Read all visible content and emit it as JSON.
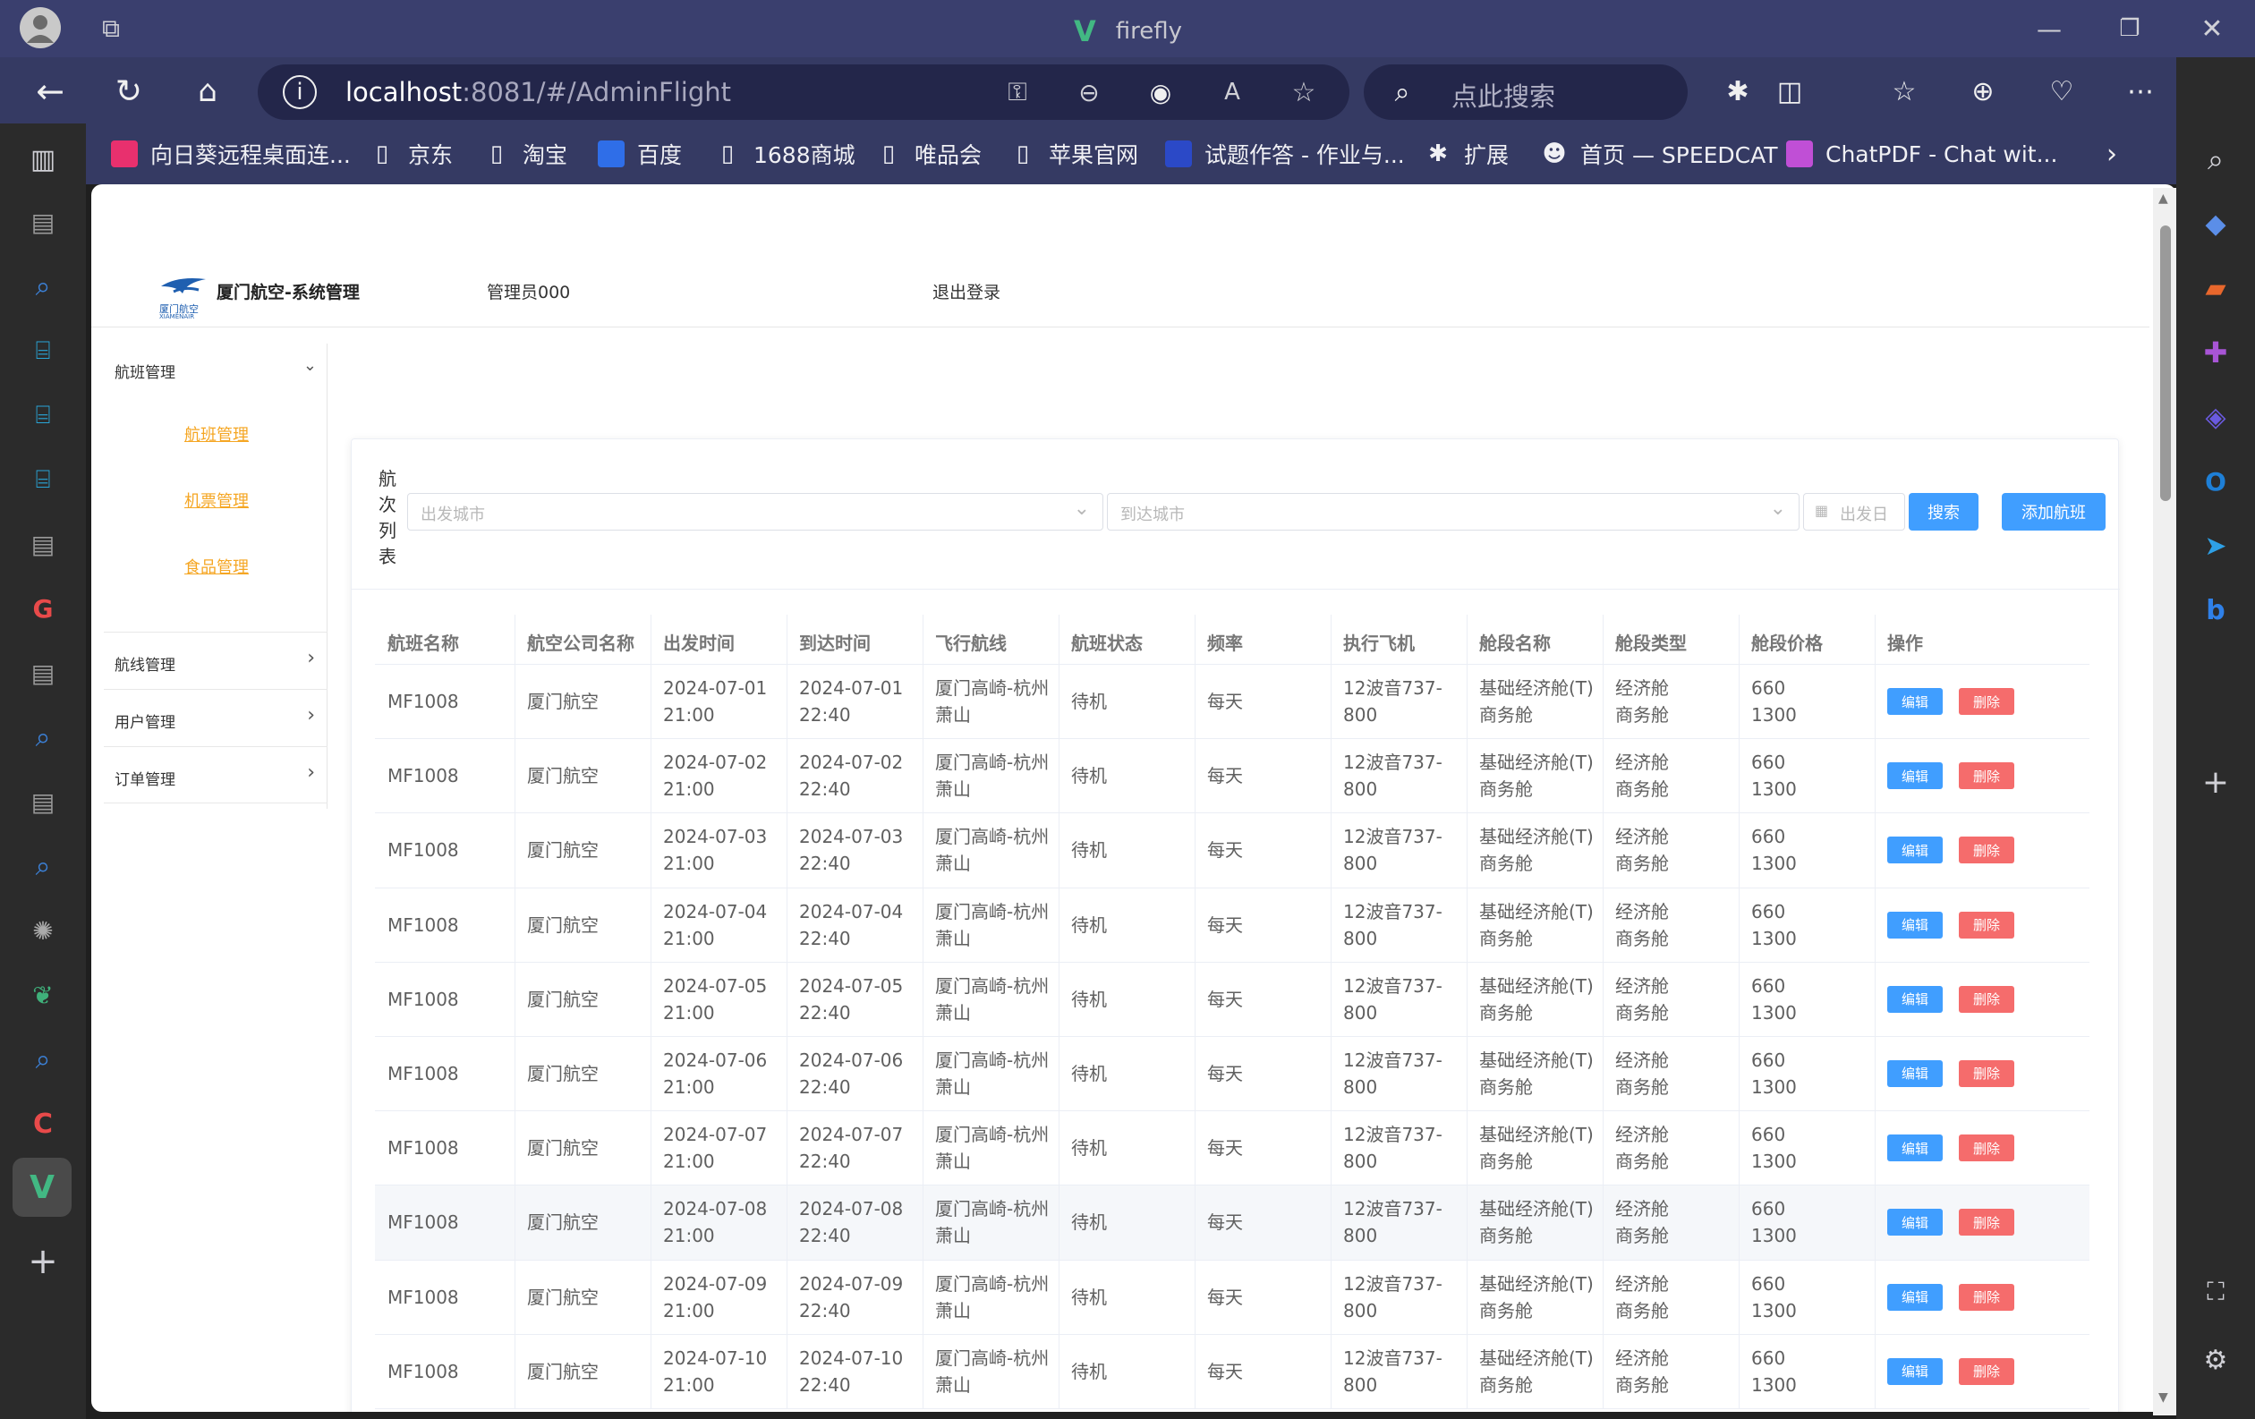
{
  "browser": {
    "window_title": "firefly",
    "url_host": "localhost",
    "url_rest": ":8081/#/AdminFlight",
    "search_placeholder": "点此搜索",
    "favorites": [
      {
        "label": "向日葵远程桌面连...",
        "icon": "sunflower-icon",
        "color": "#e8306e"
      },
      {
        "label": "京东",
        "icon": "page-icon",
        "color": "transparent"
      },
      {
        "label": "淘宝",
        "icon": "page-icon",
        "color": "transparent"
      },
      {
        "label": "百度",
        "icon": "baidu-icon",
        "color": "#2f6ee8"
      },
      {
        "label": "1688商城",
        "icon": "page-icon",
        "color": "transparent"
      },
      {
        "label": "唯品会",
        "icon": "page-icon",
        "color": "transparent"
      },
      {
        "label": "苹果官网",
        "icon": "page-icon",
        "color": "transparent"
      },
      {
        "label": "试题作答 - 作业与...",
        "icon": "u-icon",
        "color": "#2b49c7"
      },
      {
        "label": "扩展",
        "icon": "puzzle-icon",
        "color": "transparent"
      },
      {
        "label": "首页 — SPEEDCAT",
        "icon": "cat-icon",
        "color": "transparent"
      },
      {
        "label": "ChatPDF - Chat wit...",
        "icon": "chatpdf-icon",
        "color": "#c04fd6"
      }
    ]
  },
  "app": {
    "brand_title": "厦门航空-系统管理",
    "logo_text": "厦门航空",
    "logo_sub": "XIAMENAIR",
    "user": "管理员000",
    "logout": "退出登录"
  },
  "sidebar": {
    "groups": [
      {
        "label": "航班管理",
        "expanded": true,
        "children": [
          "航班管理",
          "机票管理",
          "食品管理"
        ]
      },
      {
        "label": "航线管理",
        "expanded": false
      },
      {
        "label": "用户管理",
        "expanded": false
      },
      {
        "label": "订单管理",
        "expanded": false
      }
    ]
  },
  "panel": {
    "title": "航次列表",
    "from_placeholder": "出发城市",
    "to_placeholder": "到达城市",
    "date_placeholder": "出发日",
    "search_btn": "搜索",
    "add_btn": "添加航班"
  },
  "table": {
    "columns": [
      "航班名称",
      "航空公司名称",
      "出发时间",
      "到达时间",
      "飞行航线",
      "航班状态",
      "频率",
      "执行飞机",
      "舱段名称",
      "舱段类型",
      "舱段价格",
      "操作"
    ],
    "edit_label": "编辑",
    "delete_label": "删除",
    "rows": [
      {
        "name": "MF1008",
        "company": "厦门航空",
        "dep_date": "2024-07-01",
        "dep_time": "21:00",
        "arr_date": "2024-07-01",
        "arr_time": "22:40",
        "route1": "厦门高崎-杭州",
        "route2": "萧山",
        "status": "待机",
        "freq": "每天",
        "plane1": "12波音737-",
        "plane2": "800",
        "seg1": "基础经济舱(T)",
        "seg2": "商务舱",
        "type1": "经济舱",
        "type2": "商务舱",
        "price1": "660",
        "price2": "1300"
      },
      {
        "name": "MF1008",
        "company": "厦门航空",
        "dep_date": "2024-07-02",
        "dep_time": "21:00",
        "arr_date": "2024-07-02",
        "arr_time": "22:40",
        "route1": "厦门高崎-杭州",
        "route2": "萧山",
        "status": "待机",
        "freq": "每天",
        "plane1": "12波音737-",
        "plane2": "800",
        "seg1": "基础经济舱(T)",
        "seg2": "商务舱",
        "type1": "经济舱",
        "type2": "商务舱",
        "price1": "660",
        "price2": "1300"
      },
      {
        "name": "MF1008",
        "company": "厦门航空",
        "dep_date": "2024-07-03",
        "dep_time": "21:00",
        "arr_date": "2024-07-03",
        "arr_time": "22:40",
        "route1": "厦门高崎-杭州",
        "route2": "萧山",
        "status": "待机",
        "freq": "每天",
        "plane1": "12波音737-",
        "plane2": "800",
        "seg1": "基础经济舱(T)",
        "seg2": "商务舱",
        "type1": "经济舱",
        "type2": "商务舱",
        "price1": "660",
        "price2": "1300"
      },
      {
        "name": "MF1008",
        "company": "厦门航空",
        "dep_date": "2024-07-04",
        "dep_time": "21:00",
        "arr_date": "2024-07-04",
        "arr_time": "22:40",
        "route1": "厦门高崎-杭州",
        "route2": "萧山",
        "status": "待机",
        "freq": "每天",
        "plane1": "12波音737-",
        "plane2": "800",
        "seg1": "基础经济舱(T)",
        "seg2": "商务舱",
        "type1": "经济舱",
        "type2": "商务舱",
        "price1": "660",
        "price2": "1300"
      },
      {
        "name": "MF1008",
        "company": "厦门航空",
        "dep_date": "2024-07-05",
        "dep_time": "21:00",
        "arr_date": "2024-07-05",
        "arr_time": "22:40",
        "route1": "厦门高崎-杭州",
        "route2": "萧山",
        "status": "待机",
        "freq": "每天",
        "plane1": "12波音737-",
        "plane2": "800",
        "seg1": "基础经济舱(T)",
        "seg2": "商务舱",
        "type1": "经济舱",
        "type2": "商务舱",
        "price1": "660",
        "price2": "1300"
      },
      {
        "name": "MF1008",
        "company": "厦门航空",
        "dep_date": "2024-07-06",
        "dep_time": "21:00",
        "arr_date": "2024-07-06",
        "arr_time": "22:40",
        "route1": "厦门高崎-杭州",
        "route2": "萧山",
        "status": "待机",
        "freq": "每天",
        "plane1": "12波音737-",
        "plane2": "800",
        "seg1": "基础经济舱(T)",
        "seg2": "商务舱",
        "type1": "经济舱",
        "type2": "商务舱",
        "price1": "660",
        "price2": "1300"
      },
      {
        "name": "MF1008",
        "company": "厦门航空",
        "dep_date": "2024-07-07",
        "dep_time": "21:00",
        "arr_date": "2024-07-07",
        "arr_time": "22:40",
        "route1": "厦门高崎-杭州",
        "route2": "萧山",
        "status": "待机",
        "freq": "每天",
        "plane1": "12波音737-",
        "plane2": "800",
        "seg1": "基础经济舱(T)",
        "seg2": "商务舱",
        "type1": "经济舱",
        "type2": "商务舱",
        "price1": "660",
        "price2": "1300"
      },
      {
        "name": "MF1008",
        "company": "厦门航空",
        "dep_date": "2024-07-08",
        "dep_time": "21:00",
        "arr_date": "2024-07-08",
        "arr_time": "22:40",
        "route1": "厦门高崎-杭州",
        "route2": "萧山",
        "status": "待机",
        "freq": "每天",
        "plane1": "12波音737-",
        "plane2": "800",
        "seg1": "基础经济舱(T)",
        "seg2": "商务舱",
        "type1": "经济舱",
        "type2": "商务舱",
        "price1": "660",
        "price2": "1300"
      },
      {
        "name": "MF1008",
        "company": "厦门航空",
        "dep_date": "2024-07-09",
        "dep_time": "21:00",
        "arr_date": "2024-07-09",
        "arr_time": "22:40",
        "route1": "厦门高崎-杭州",
        "route2": "萧山",
        "status": "待机",
        "freq": "每天",
        "plane1": "12波音737-",
        "plane2": "800",
        "seg1": "基础经济舱(T)",
        "seg2": "商务舱",
        "type1": "经济舱",
        "type2": "商务舱",
        "price1": "660",
        "price2": "1300"
      },
      {
        "name": "MF1008",
        "company": "厦门航空",
        "dep_date": "2024-07-10",
        "dep_time": "21:00",
        "arr_date": "2024-07-10",
        "arr_time": "22:40",
        "route1": "厦门高崎-杭州",
        "route2": "萧山",
        "status": "待机",
        "freq": "每天",
        "plane1": "12波音737-",
        "plane2": "800",
        "seg1": "基础经济舱(T)",
        "seg2": "商务舱",
        "type1": "经济舱",
        "type2": "商务舱",
        "price1": "660",
        "price2": "1300"
      }
    ]
  },
  "colors": {
    "accent": "#409eff",
    "danger": "#f56c6c",
    "submenu": "#f5a623"
  }
}
